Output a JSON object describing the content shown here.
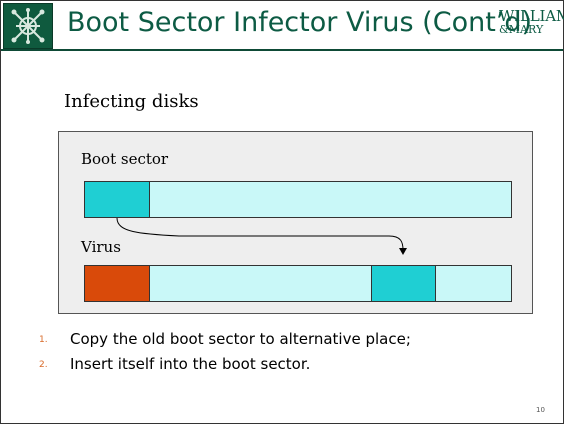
{
  "header": {
    "title": "Boot Sector Infector Virus (Cont’d)",
    "brand_line1": "WILLIAM",
    "brand_line2": "&MARY",
    "logo_icon": "cypher-crest-icon"
  },
  "content": {
    "subheading": "Infecting disks",
    "diagram": {
      "label_top": "Boot sector",
      "label_bottom": "Virus",
      "colors": {
        "panel": "#eeeeee",
        "boot_sector": "#1fcfd3",
        "disk": "#c9f8f8",
        "virus": "#d94a0a",
        "copied_sector": "#1fcfd3"
      }
    },
    "steps": [
      {
        "num": "1.",
        "text": "Copy the old boot sector to alternative place;"
      },
      {
        "num": "2.",
        "text": "Insert itself into the boot sector."
      }
    ]
  },
  "footer": {
    "page_number": "10"
  }
}
